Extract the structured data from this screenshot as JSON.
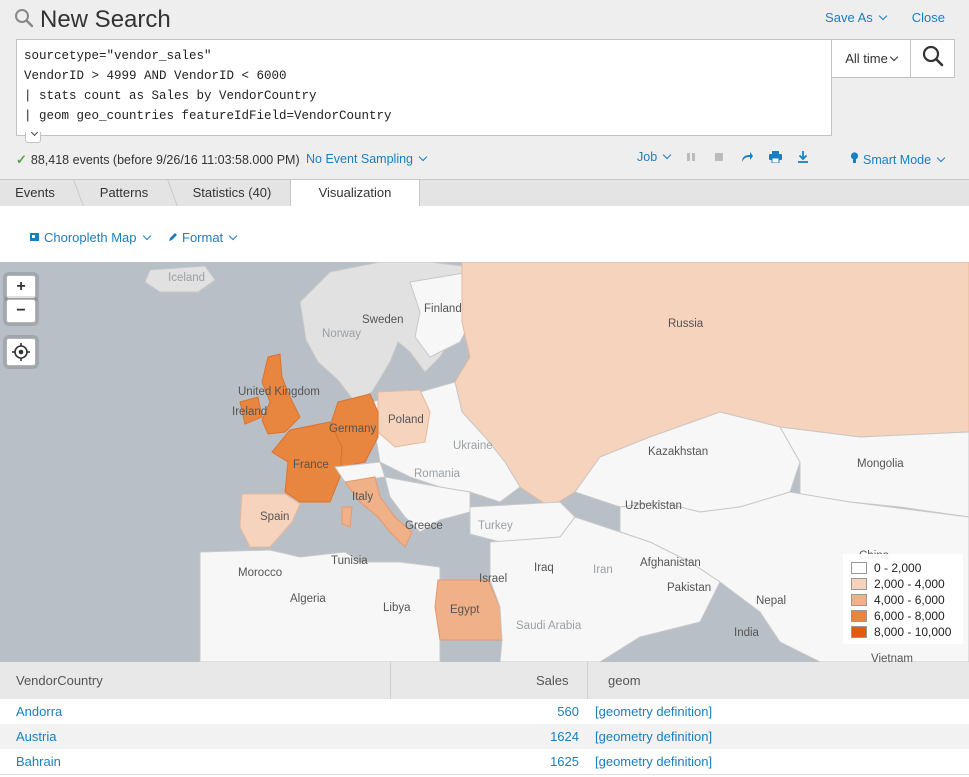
{
  "header": {
    "title": "New Search",
    "save_as_label": "Save As",
    "close_label": "Close"
  },
  "search": {
    "query_lines": [
      "sourcetype=\"vendor_sales\"",
      "VendorID > 4999 AND VendorID < 6000",
      "| stats count as Sales by VendorCountry",
      "| geom geo_countries featureIdField=VendorCountry"
    ],
    "time_range": "All time"
  },
  "status": {
    "events_text": "88,418 events (before 9/26/16 11:03:58.000 PM)",
    "sampling_label": "No Event Sampling",
    "job_label": "Job",
    "mode_label": "Smart Mode"
  },
  "tabs": [
    {
      "label": "Events"
    },
    {
      "label": "Patterns"
    },
    {
      "label": "Statistics (40)"
    },
    {
      "label": "Visualization"
    }
  ],
  "viz": {
    "type_label": "Choropleth Map",
    "format_label": "Format"
  },
  "map": {
    "zoom_in": "+",
    "zoom_out": "−",
    "labels": [
      "Iceland",
      "Sweden",
      "Finland",
      "Norway",
      "Russia",
      "United Kingdom",
      "Ireland",
      "Germany",
      "Poland",
      "France",
      "Ukraine",
      "Romania",
      "Kazakhstan",
      "Mongolia",
      "Spain",
      "Italy",
      "Greece",
      "Turkey",
      "Uzbekistan",
      "China",
      "Morocco",
      "Tunisia",
      "Algeria",
      "Libya",
      "Israel",
      "Iraq",
      "Iran",
      "Afghanistan",
      "Pakistan",
      "Nepal",
      "Egypt",
      "Saudi Arabia",
      "India",
      "Vietnam"
    ],
    "legend": [
      {
        "range": "0 - 2,000",
        "color": "#ffffff"
      },
      {
        "range": "2,000 - 4,000",
        "color": "#f6d3bc"
      },
      {
        "range": "4,000 - 6,000",
        "color": "#f0b088"
      },
      {
        "range": "6,000 - 8,000",
        "color": "#e8853f"
      },
      {
        "range": "8,000 - 10,000",
        "color": "#e05a12"
      }
    ],
    "colors": {
      "water": "#b8bfc6",
      "land_nodata": "#e1e1e1",
      "land_white": "#f7f7f7",
      "border": "#c8c8c8"
    }
  },
  "table": {
    "columns": [
      "VendorCountry",
      "Sales",
      "geom"
    ],
    "rows": [
      {
        "country": "Andorra",
        "sales": "560",
        "geom": "[geometry definition]"
      },
      {
        "country": "Austria",
        "sales": "1624",
        "geom": "[geometry definition]"
      },
      {
        "country": "Bahrain",
        "sales": "1625",
        "geom": "[geometry definition]"
      }
    ]
  },
  "colors": {
    "accent": "#1a7fc1",
    "success": "#5aa24a"
  }
}
